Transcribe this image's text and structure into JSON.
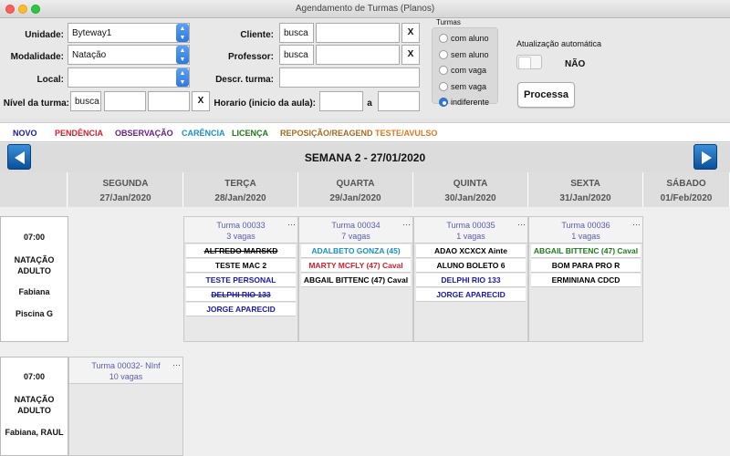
{
  "window": {
    "title": "Agendamento de Turmas (Planos)"
  },
  "form": {
    "unidade_label": "Unidade:",
    "unidade_value": "Byteway1",
    "modalidade_label": "Modalidade:",
    "modalidade_value": "Natação",
    "local_label": "Local:",
    "local_value": "",
    "nivel_label": "Nível da turma:",
    "busca_label": "busca",
    "x_label": "X",
    "cliente_label": "Cliente:",
    "professor_label": "Professor:",
    "descr_label": "Descr. turma:",
    "horario_label": "Horario (inicio da aula):",
    "horario_sep": "a"
  },
  "turmas": {
    "title": "Turmas",
    "options": [
      "com aluno",
      "sem aluno",
      "com vaga",
      "sem vaga",
      "indiferente"
    ],
    "selected": "indiferente"
  },
  "auto_update": {
    "label": "Atualização automática",
    "value": "NÃO"
  },
  "processa_label": "Processa",
  "legend": [
    {
      "label": "NOVO",
      "color": "#1a1aa8"
    },
    {
      "label": "PENDÊNCIA",
      "color": "#d4202a"
    },
    {
      "label": "OBSERVAÇÃO",
      "color": "#6a1f8a"
    },
    {
      "label": "CARÊNCIA",
      "color": "#1a8fc4"
    },
    {
      "label": "LICENÇA",
      "color": "#1b7a1b"
    },
    {
      "label": "REPOSIÇÃO/REAGEND",
      "color": "#a86a1c"
    },
    {
      "label": "TESTE/AVULSO",
      "color": "#e07820"
    }
  ],
  "week_title": "SEMANA 2 - 27/01/2020",
  "days": [
    {
      "name": "SEGUNDA",
      "date": "27/Jan/2020"
    },
    {
      "name": "TERÇA",
      "date": "28/Jan/2020"
    },
    {
      "name": "QUARTA",
      "date": "29/Jan/2020"
    },
    {
      "name": "QUINTA",
      "date": "30/Jan/2020"
    },
    {
      "name": "SEXTA",
      "date": "31/Jan/2020"
    },
    {
      "name": "SÁBADO",
      "date": "01/Feb/2020"
    }
  ],
  "slots": [
    {
      "time": "07:00",
      "modality": [
        "NATAÇÃO",
        "ADULTO"
      ],
      "teacher": "Fabiana",
      "place": "Piscina G"
    },
    {
      "time": "07:00",
      "modality": [
        "NATAÇÃO",
        "ADULTO"
      ],
      "teacher": "Fabiana, RAUL",
      "place": ""
    }
  ],
  "classes_row1": [
    {
      "name": "Turma 00033",
      "vagas": "3 vagas",
      "students": [
        {
          "name": "ALFREDO MARSKD",
          "color": "#000000",
          "strike": true
        },
        {
          "name": "TESTE MAC 2",
          "color": "#000000",
          "strike": false
        },
        {
          "name": "TESTE PERSONAL",
          "color": "#1a1aa8",
          "strike": false
        },
        {
          "name": "DELPHI RIO 133",
          "color": "#1a1aa8",
          "strike": true
        },
        {
          "name": "JORGE APARECID",
          "color": "#1a1aa8",
          "strike": false
        }
      ]
    },
    {
      "name": "Turma 00034",
      "vagas": "7 vagas",
      "students": [
        {
          "name": "ADALBETO GONZA (45)",
          "color": "#1a8fc4",
          "strike": false
        },
        {
          "name": "MARTY MCFLY (47) Caval",
          "color": "#d4202a",
          "strike": false
        },
        {
          "name": "ABGAIL BITTENC (47) Caval",
          "color": "#000000",
          "strike": false
        }
      ]
    },
    {
      "name": "Turma 00035",
      "vagas": "1 vagas",
      "students": [
        {
          "name": "ADAO XCXCX Ainte",
          "color": "#000000",
          "strike": false
        },
        {
          "name": "ALUNO BOLETO 6",
          "color": "#000000",
          "strike": false
        },
        {
          "name": "DELPHI RIO 133",
          "color": "#1a1aa8",
          "strike": false
        },
        {
          "name": "JORGE APARECID",
          "color": "#1a1aa8",
          "strike": false
        }
      ]
    },
    {
      "name": "Turma 00036",
      "vagas": "1 vagas",
      "students": [
        {
          "name": "ABGAIL BITTENC (47) Caval",
          "color": "#1b7a1b",
          "strike": false
        },
        {
          "name": "BOM PARA PRO R",
          "color": "#000000",
          "strike": false
        },
        {
          "name": "ERMINIANA CDCD",
          "color": "#000000",
          "strike": false
        }
      ]
    }
  ],
  "classes_row2": [
    {
      "name": "Turma 00032- NInf",
      "vagas": "10 vagas",
      "students": []
    }
  ],
  "more_label": "···"
}
